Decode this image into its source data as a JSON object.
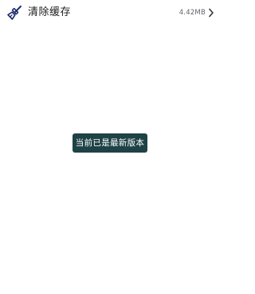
{
  "cache_row": {
    "title": "清除缓存",
    "size": "4.42MB",
    "icon": "broom-icon",
    "chevron_icon": "chevron-right-icon"
  },
  "toast": {
    "message": "当前已是最新版本"
  },
  "colors": {
    "icon": "#1f2b6b",
    "toast_bg": "#1f4246",
    "title_text": "#1c1c1c",
    "value_text": "#5f6368"
  }
}
